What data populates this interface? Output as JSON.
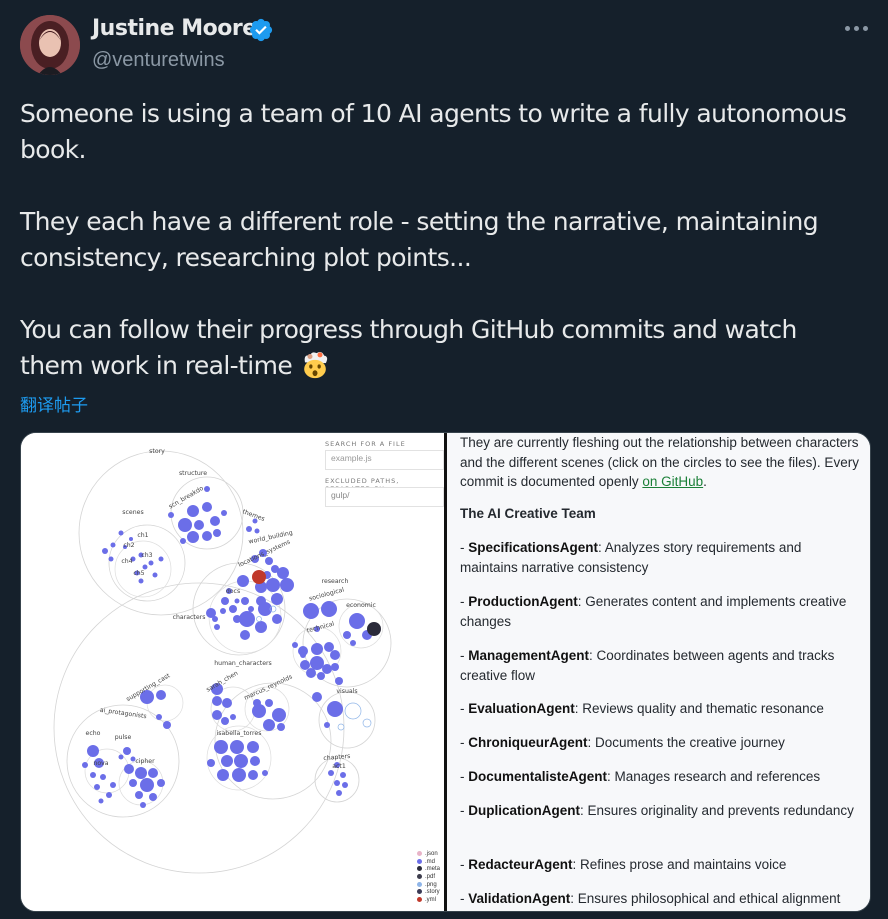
{
  "tweet": {
    "author_name": "Justine Moore",
    "handle": "@venturetwins",
    "paragraphs": [
      "Someone is using a team of 10 AI agents to write a fully autonomous book.",
      "They each have a different role - setting the narrative, maintaining consistency, researching plot points...",
      "You can follow their progress through GitHub commits and watch them work in real-time"
    ],
    "translate_label": "翻译帖子"
  },
  "visualization": {
    "search_label": "SEARCH FOR A FILE",
    "search_placeholder": "example.js",
    "excluded_label": "EXCLUDED PATHS, SEPARATED BY ,",
    "excluded_value": "gulp/",
    "labels": {
      "story": "story",
      "structure": "structure",
      "scenes": "scenes",
      "ch1": "ch1",
      "ch2": "ch2",
      "ch3": "ch3",
      "ch4": "ch4",
      "ch5": "ch5",
      "scene_breakdown": "scn_breakdo",
      "themes": "themes",
      "world_building": "world_building",
      "locations_systems": "locations_systems",
      "docs": "docs",
      "research": "research",
      "sociological": "sociological",
      "economic": "economic",
      "technical": "technical",
      "characters": "characters",
      "human_characters": "human_characters",
      "sarah_chen": "sarah_chen",
      "marcus_reynolds": "marcus_reynolds",
      "isabella_torres": "isabella_torres",
      "supporting_cast": "supporting_cast",
      "ai_protagonists": "ai_protagonists",
      "echo": "echo",
      "pulse": "pulse",
      "nova": "nova",
      "cipher": "cipher",
      "visuals": "visuals",
      "chapters": "chapters",
      "act1": "act1"
    },
    "legend": [
      {
        "label": ".json",
        "color": "#e8b4c8"
      },
      {
        "label": ".md",
        "color": "#6b6ee8"
      },
      {
        "label": ".meta",
        "color": "#2b2b3a"
      },
      {
        "label": ".pdf",
        "color": "#3d3d4d"
      },
      {
        "label": ".png",
        "color": "#8fb5e8"
      },
      {
        "label": ".story",
        "color": "#3a3a55"
      },
      {
        "label": ".yml",
        "color": "#c0392b"
      }
    ]
  },
  "doc": {
    "intro_text": "They are currently fleshing out the relationship between characters and the different scenes (click on the circles to see the files). Every commit is documented openly",
    "intro_link": "on GitHub",
    "intro_end": ".",
    "team_title": "The AI Creative Team",
    "agents": [
      {
        "name": "SpecificationsAgent",
        "desc": ": Analyzes story requirements and maintains narrative consistency"
      },
      {
        "name": "ProductionAgent",
        "desc": ": Generates content and implements creative changes"
      },
      {
        "name": "ManagementAgent",
        "desc": ": Coordinates between agents and tracks creative flow"
      },
      {
        "name": "EvaluationAgent",
        "desc": ": Reviews quality and thematic resonance"
      },
      {
        "name": "ChroniqueurAgent",
        "desc": ": Documents the creative journey"
      },
      {
        "name": "DocumentalisteAgent",
        "desc": ": Manages research and references"
      },
      {
        "name": "DuplicationAgent",
        "desc": ": Ensures originality and prevents redundancy"
      },
      {
        "name": "RedacteurAgent",
        "desc": ": Refines prose and maintains voice"
      },
      {
        "name": "ValidationAgent",
        "desc": ": Ensures philosophical and ethical alignment"
      }
    ]
  },
  "colors": {
    "background": "#15202b",
    "link": "#1d9bf0",
    "secondary": "#8b98a5",
    "bubble": "#6b6ee8",
    "yml": "#c0392b",
    "meta": "#2b2b3a"
  },
  "icons": [
    "verified-badge-icon",
    "more-options-icon",
    "exploding-head-emoji"
  ]
}
